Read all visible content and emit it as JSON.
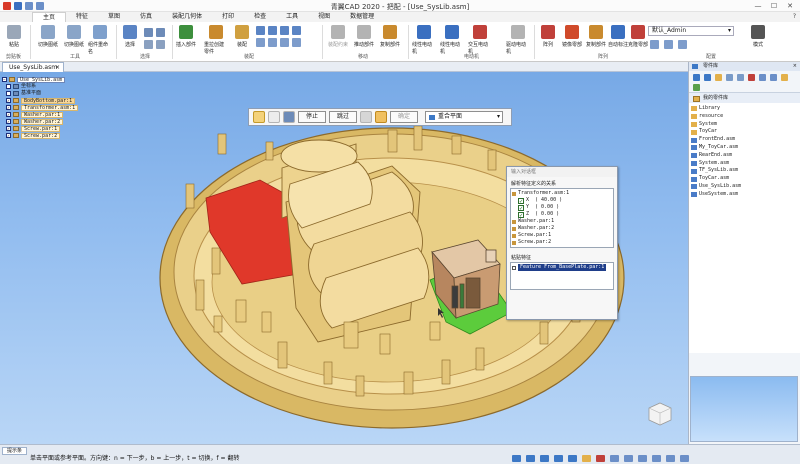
{
  "window": {
    "title": "青翼CAD 2020 - 把配 - [Use_SysLib.asm]",
    "controls": [
      "—",
      "☐",
      "✕"
    ]
  },
  "menu": {
    "tabs": [
      "主页",
      "特征",
      "草图",
      "仿真",
      "装配几何体",
      "打印",
      "检查",
      "工具",
      "视图",
      "数据管理"
    ],
    "active": "主页",
    "help": "?"
  },
  "ribbon": {
    "buttons": [
      {
        "label": "粘贴",
        "color": "#9aa7b8"
      },
      {
        "label": "切换图纸",
        "color": "#8aa5c8"
      },
      {
        "label": "切换图纸",
        "color": "#8aa5c8"
      },
      {
        "label": "组件重命名",
        "color": "#7ea0cc"
      },
      {
        "label": "选择",
        "color": "#5a84c4"
      },
      {
        "label": "插入部件",
        "color": "#3d8f3d"
      },
      {
        "label": "重拉创建零件",
        "color": "#c98a2e"
      },
      {
        "label": "装配",
        "color": "#d0a040"
      },
      {
        "label": "装配约束",
        "color": "#b3b3b3"
      },
      {
        "label": "推动部件",
        "color": "#b3b3b3"
      },
      {
        "label": "复制部件",
        "color": "#c98a2e"
      },
      {
        "label": "线性电动机",
        "color": "#3a6fc0"
      },
      {
        "label": "线性电动机",
        "color": "#3a6fc0"
      },
      {
        "label": "交互电动机",
        "color": "#c0403a"
      },
      {
        "label": "驱动电动机",
        "color": "#b3b3b3"
      },
      {
        "label": "阵列",
        "color": "#c0403a"
      },
      {
        "label": "镜像零部",
        "color": "#d04a2a"
      },
      {
        "label": "复制部件",
        "color": "#c98a2e"
      },
      {
        "label": "自动标注",
        "color": "#3a6fc0"
      },
      {
        "label": "克隆零部",
        "color": "#c0403a"
      },
      {
        "label": "模式",
        "color": "#555555"
      }
    ],
    "groups": [
      "剪贴板",
      "工具",
      "选择",
      "装配",
      "移动",
      "电动机",
      "阵列",
      "配置"
    ],
    "config_select": "默认_Admin"
  },
  "document_tab": {
    "label": "Use_SysLib.asm",
    "close": "×"
  },
  "scene_tree": [
    {
      "label": "Use_SysLib.asm",
      "root": true
    },
    {
      "label": "坐标系"
    },
    {
      "label": "基准平面"
    },
    {
      "label": "BodyBottom.par:1",
      "selected": true
    },
    {
      "label": "Transformer.asm:1"
    },
    {
      "label": "Washer.par:1"
    },
    {
      "label": "Washer.par:2"
    },
    {
      "label": "Screw.par:1"
    },
    {
      "label": "Screw.par:2"
    }
  ],
  "float_toolbar": {
    "stop": "停止",
    "skip": "跳过",
    "confirm": "确定",
    "plane_select": "重合平面"
  },
  "input_dialog": {
    "title": "输入对话框",
    "define_label": "解析特征定义的关系",
    "relation_rows": [
      {
        "text": "Transformer.asm:1",
        "type": "part"
      },
      {
        "text": "X",
        "value": "( 40.00 )",
        "type": "check"
      },
      {
        "text": "Y",
        "value": "( 0.00 )",
        "type": "check"
      },
      {
        "text": "Z",
        "value": "( 0.00 )",
        "type": "check"
      },
      {
        "text": "Washer.par:1",
        "type": "part"
      },
      {
        "text": "Washer.par:2",
        "type": "part"
      },
      {
        "text": "Screw.par:1",
        "type": "part"
      },
      {
        "text": "Screw.par:2",
        "type": "part"
      }
    ],
    "feature_label": "粘贴特征",
    "feature_rows": [
      "Feature From_BasePlate.par:1"
    ]
  },
  "right_panel": {
    "title": "零件库",
    "close": "×",
    "section": "我的零件库",
    "items": [
      {
        "label": "Library",
        "kind": "folder"
      },
      {
        "label": "resource",
        "kind": "folder"
      },
      {
        "label": "System",
        "kind": "folder"
      },
      {
        "label": "ToyCar",
        "kind": "folder"
      },
      {
        "label": "FrontEnd.asm",
        "kind": "file"
      },
      {
        "label": "My_ToyCar.asm",
        "kind": "file"
      },
      {
        "label": "RearEnd.asm",
        "kind": "file"
      },
      {
        "label": "System.asm",
        "kind": "file"
      },
      {
        "label": "TF_SysLib.asm",
        "kind": "file"
      },
      {
        "label": "ToyCar.asm",
        "kind": "file"
      },
      {
        "label": "Use_SysLib.asm",
        "kind": "file"
      },
      {
        "label": "UseSystem.asm",
        "kind": "file"
      }
    ]
  },
  "status": {
    "tab": "提示条",
    "text": "单击平面或参考平面。方向键：n = 下一步，b = 上一步，t = 切换，f = 翻转"
  },
  "colors": {
    "part_tan": "#ead08a",
    "part_edge": "#8c6a2c",
    "highlight_red": "#e0382a",
    "highlight_green": "#5ccc3c",
    "selection_blue": "#1f3e8a"
  }
}
